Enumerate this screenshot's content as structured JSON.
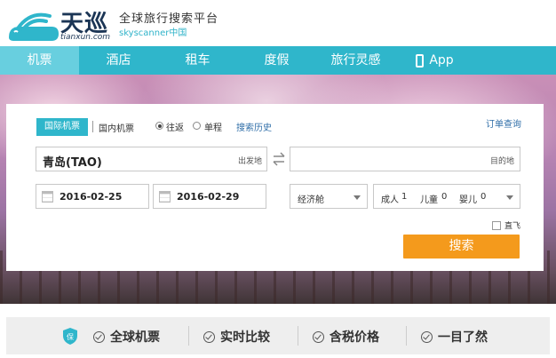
{
  "header": {
    "brand_name": "天巡",
    "brand_url": "tianxun.com",
    "tagline": "全球旅行搜索平台",
    "sub_brand": "skyscanner中国"
  },
  "nav": {
    "items": [
      {
        "label": "机票",
        "active": true
      },
      {
        "label": "酒店",
        "active": false
      },
      {
        "label": "租车",
        "active": false
      },
      {
        "label": "度假",
        "active": false
      },
      {
        "label": "旅行灵感",
        "active": false
      }
    ],
    "app_label": "App"
  },
  "search": {
    "tab_international": "国际机票",
    "tab_domestic": "国内机票",
    "trip_round": "往返",
    "trip_oneway": "单程",
    "trip_selected": "往返",
    "history_link": "搜索历史",
    "order_link": "订单查询",
    "from_value": "青岛(TAO)",
    "from_label": "出发地",
    "to_label": "目的地",
    "depart_date": "2016-02-25",
    "return_date": "2016-02-29",
    "cabin": "经济舱",
    "adults_label": "成人",
    "adults": "1",
    "children_label": "儿童",
    "children": "0",
    "infants_label": "婴儿",
    "infants": "0",
    "direct_label": "直飞",
    "search_button": "搜索"
  },
  "features": [
    "全球机票",
    "实时比较",
    "含税价格",
    "一目了然"
  ],
  "colors": {
    "nav": "#2fb6cb",
    "nav_active": "#68cfdf",
    "search_button": "#f49a1c",
    "link": "#2f6ea8"
  }
}
